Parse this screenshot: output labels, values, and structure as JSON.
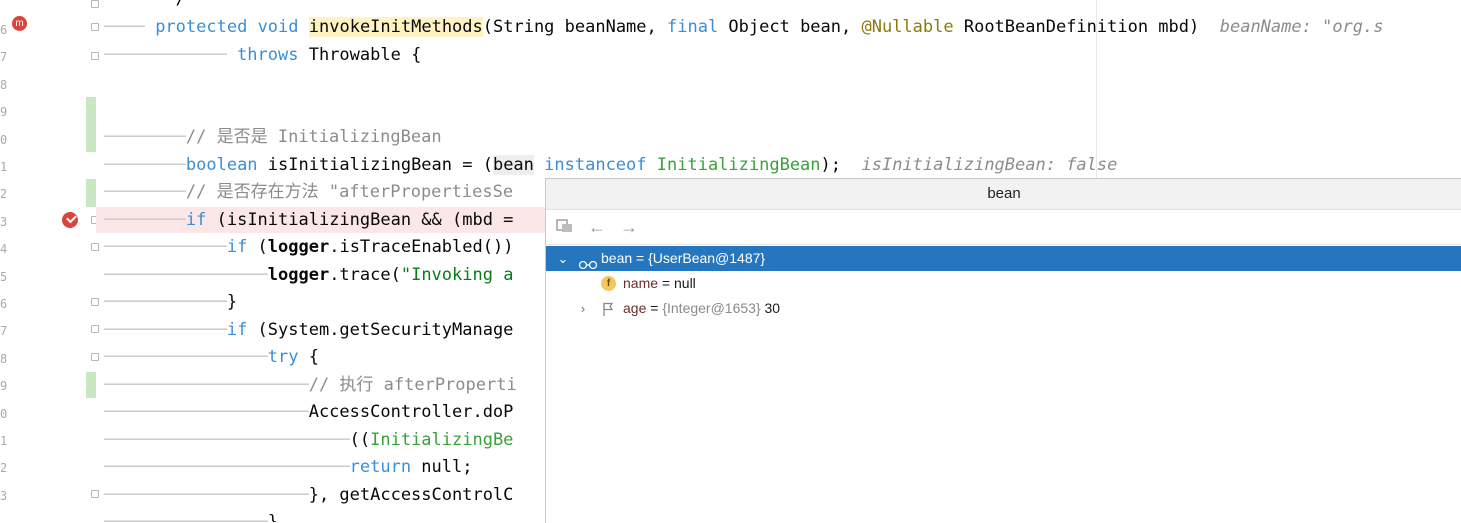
{
  "gutter": {
    "line_number_fragments": [
      "6",
      "7",
      "8",
      "9",
      "0",
      "1",
      "2",
      "3",
      "4",
      "5",
      "6",
      "7",
      "8",
      "9",
      "0",
      "1",
      "2",
      "3"
    ],
    "method_badge": "m"
  },
  "code": {
    "line1_comment_end": "*/",
    "line2": {
      "kw_protected": "protected",
      "kw_void": "void",
      "method": "invokeInitMethods",
      "params_a": "(String beanName, ",
      "kw_final": "final",
      "params_b": " Object bean, ",
      "annotation": "@Nullable",
      "params_c": " RootBeanDefinition mbd)",
      "hint": "beanName: \"org.s"
    },
    "line3": {
      "kw_throws": "throws",
      "rest": " Throwable {"
    },
    "line6_comment": "// 是否是 InitializingBean",
    "line7": {
      "kw_boolean": "boolean",
      "a": " isInitializingBean = (",
      "bean": "bean",
      "b": " ",
      "kw_instanceof": "instanceof",
      "c": " ",
      "cls": "InitializingBean",
      "d": ");",
      "hint": "isInitializingBean: false"
    },
    "line8_comment": "// 是否存在方法 \"afterPropertiesSe",
    "line9": {
      "kw_if": "if",
      "rest": " (isInitializingBean && (mbd ="
    },
    "line10": {
      "kw_if": "if",
      "a": " (",
      "logger": "logger",
      "b": ".isTraceEnabled())"
    },
    "line11": {
      "logger": "logger",
      "a": ".trace(",
      "str": "\"Invoking a"
    },
    "line12": "}",
    "line13": {
      "kw_if": "if",
      "rest": " (System.getSecurityManage"
    },
    "line14": {
      "kw_try": "try",
      "rest": " {"
    },
    "line15_comment": "// 执行 afterProperti",
    "line16": "AccessController.doP",
    "line17": {
      "a": "((",
      "cls": "InitializingBe"
    },
    "line18": {
      "kw_return": "return",
      "rest": " null;"
    },
    "line19": "}, getAccessControlC",
    "line20": "}"
  },
  "debug_popup": {
    "title": "bean",
    "toolbar": {
      "pin_icon": "watch-add-icon",
      "back_icon": "arrow-left-icon",
      "forward_icon": "arrow-right-icon"
    },
    "tree": [
      {
        "name": "bean",
        "eq": " = ",
        "value_type": "{UserBean@1487}",
        "value": "",
        "expanded": true,
        "icon": "glasses-icon"
      },
      {
        "name": "name",
        "eq": " = ",
        "value_type": "",
        "value": "null",
        "expanded": false,
        "icon": "field-icon",
        "badge": "f"
      },
      {
        "name": "age",
        "eq": " = ",
        "value_type": "{Integer@1653}",
        "value": " 30",
        "expanded": false,
        "icon": "flag-icon"
      }
    ]
  },
  "colors": {
    "keyword": "#3b8ed8",
    "class": "#3aa23a",
    "string": "#067d17",
    "breakpoint": "#d9453d",
    "selection": "#2675bf"
  }
}
